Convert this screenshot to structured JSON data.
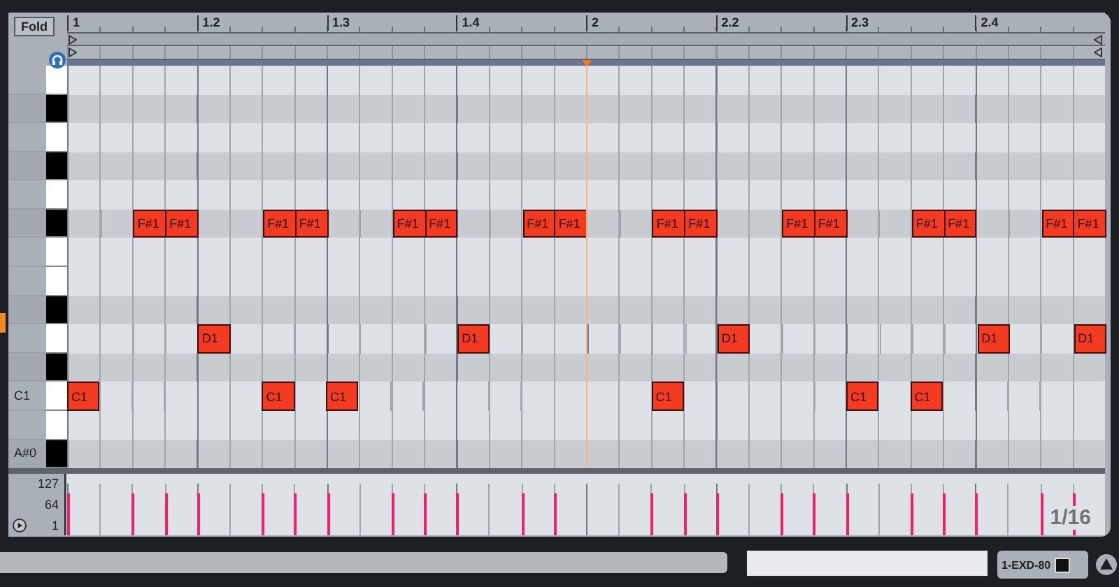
{
  "fold_button": {
    "label": "Fold"
  },
  "ruler": {
    "labels": [
      "1",
      "1.2",
      "1.3",
      "1.4",
      "2",
      "2.2",
      "2.3",
      "2.4"
    ]
  },
  "rows": [
    {
      "kind": "white"
    },
    {
      "kind": "black"
    },
    {
      "kind": "white"
    },
    {
      "kind": "black"
    },
    {
      "kind": "white"
    },
    {
      "kind": "black",
      "cells": [
        {
          "kind": "empty"
        },
        {
          "kind": "empty"
        },
        {
          "kind": "note",
          "label": "F#1"
        },
        {
          "kind": "note",
          "label": "F#1"
        },
        {
          "kind": "empty"
        },
        {
          "kind": "empty"
        },
        {
          "kind": "note",
          "label": "F#1"
        },
        {
          "kind": "note",
          "label": "F#1"
        },
        {
          "kind": "empty"
        },
        {
          "kind": "empty"
        },
        {
          "kind": "note",
          "label": "F#1"
        },
        {
          "kind": "note",
          "label": "F#1"
        },
        {
          "kind": "empty"
        },
        {
          "kind": "empty"
        },
        {
          "kind": "note",
          "label": "F#1"
        },
        {
          "kind": "note",
          "label": "F#1"
        },
        {
          "kind": "empty"
        },
        {
          "kind": "empty"
        },
        {
          "kind": "note",
          "label": "F#1"
        },
        {
          "kind": "note",
          "label": "F#1"
        },
        {
          "kind": "empty"
        },
        {
          "kind": "empty"
        },
        {
          "kind": "note",
          "label": "F#1"
        },
        {
          "kind": "note",
          "label": "F#1"
        },
        {
          "kind": "empty"
        },
        {
          "kind": "empty"
        },
        {
          "kind": "note",
          "label": "F#1"
        },
        {
          "kind": "note",
          "label": "F#1"
        },
        {
          "kind": "empty"
        },
        {
          "kind": "empty"
        },
        {
          "kind": "note",
          "label": "F#1"
        },
        {
          "kind": "note",
          "label": "F#1"
        }
      ]
    },
    {
      "kind": "white"
    },
    {
      "kind": "white"
    },
    {
      "kind": "black"
    },
    {
      "kind": "white",
      "cells": [
        {
          "kind": "empty"
        },
        {
          "kind": "empty"
        },
        {
          "kind": "empty"
        },
        {
          "kind": "empty"
        },
        {
          "kind": "note",
          "label": "D1"
        },
        {
          "kind": "empty"
        },
        {
          "kind": "empty"
        },
        {
          "kind": "empty"
        },
        {
          "kind": "empty"
        },
        {
          "kind": "empty"
        },
        {
          "kind": "empty"
        },
        {
          "kind": "empty"
        },
        {
          "kind": "note",
          "label": "D1"
        },
        {
          "kind": "empty"
        },
        {
          "kind": "empty"
        },
        {
          "kind": "empty"
        },
        {
          "kind": "empty"
        },
        {
          "kind": "empty"
        },
        {
          "kind": "empty"
        },
        {
          "kind": "empty"
        },
        {
          "kind": "note",
          "label": "D1"
        },
        {
          "kind": "empty"
        },
        {
          "kind": "empty"
        },
        {
          "kind": "empty"
        },
        {
          "kind": "empty"
        },
        {
          "kind": "empty"
        },
        {
          "kind": "empty"
        },
        {
          "kind": "empty"
        },
        {
          "kind": "note",
          "label": "D1"
        },
        {
          "kind": "empty"
        },
        {
          "kind": "empty"
        },
        {
          "kind": "note",
          "label": "D1"
        }
      ]
    },
    {
      "kind": "black"
    },
    {
      "kind": "white",
      "label": "C1",
      "cells": [
        {
          "kind": "note",
          "label": "C1"
        },
        {
          "kind": "empty"
        },
        {
          "kind": "empty"
        },
        {
          "kind": "empty"
        },
        {
          "kind": "empty"
        },
        {
          "kind": "empty"
        },
        {
          "kind": "note",
          "label": "C1"
        },
        {
          "kind": "empty"
        },
        {
          "kind": "note",
          "label": "C1"
        },
        {
          "kind": "empty"
        },
        {
          "kind": "empty"
        },
        {
          "kind": "empty"
        },
        {
          "kind": "empty"
        },
        {
          "kind": "empty"
        },
        {
          "kind": "empty"
        },
        {
          "kind": "empty"
        },
        {
          "kind": "empty"
        },
        {
          "kind": "empty"
        },
        {
          "kind": "note",
          "label": "C1"
        },
        {
          "kind": "empty"
        },
        {
          "kind": "empty"
        },
        {
          "kind": "empty"
        },
        {
          "kind": "empty"
        },
        {
          "kind": "empty"
        },
        {
          "kind": "note",
          "label": "C1"
        },
        {
          "kind": "empty"
        },
        {
          "kind": "note",
          "label": "C1"
        },
        {
          "kind": "empty"
        },
        {
          "kind": "empty"
        },
        {
          "kind": "empty"
        },
        {
          "kind": "empty"
        },
        {
          "kind": "empty"
        }
      ]
    },
    {
      "kind": "white"
    },
    {
      "kind": "black",
      "label": "A#0"
    }
  ],
  "velocity_lane": {
    "labels": [
      "127",
      "64",
      "1"
    ],
    "bars": [
      {
        "kind": "bar",
        "level": 0.8
      },
      {
        "kind": "empty"
      },
      {
        "kind": "bar",
        "level": 0.8
      },
      {
        "kind": "bar",
        "level": 0.8
      },
      {
        "kind": "bar",
        "level": 0.8
      },
      {
        "kind": "empty"
      },
      {
        "kind": "bar",
        "level": 0.8
      },
      {
        "kind": "bar",
        "level": 0.8
      },
      {
        "kind": "bar",
        "level": 0.8
      },
      {
        "kind": "empty"
      },
      {
        "kind": "bar",
        "level": 0.8
      },
      {
        "kind": "bar",
        "level": 0.8
      },
      {
        "kind": "bar",
        "level": 0.8
      },
      {
        "kind": "empty"
      },
      {
        "kind": "bar",
        "level": 0.8
      },
      {
        "kind": "bar",
        "level": 0.8
      },
      {
        "kind": "empty"
      },
      {
        "kind": "empty"
      },
      {
        "kind": "bar",
        "level": 0.8
      },
      {
        "kind": "bar",
        "level": 0.8
      },
      {
        "kind": "bar",
        "level": 0.8
      },
      {
        "kind": "empty"
      },
      {
        "kind": "bar",
        "level": 0.8
      },
      {
        "kind": "bar",
        "level": 0.8
      },
      {
        "kind": "bar",
        "level": 0.8
      },
      {
        "kind": "empty"
      },
      {
        "kind": "bar",
        "level": 0.8
      },
      {
        "kind": "bar",
        "level": 0.8
      },
      {
        "kind": "bar",
        "level": 0.8
      },
      {
        "kind": "empty"
      },
      {
        "kind": "bar",
        "level": 0.8
      },
      {
        "kind": "bar",
        "level": 0.8
      }
    ]
  },
  "grid_label": "1/16",
  "device_button": {
    "label": "1-EXD-80"
  }
}
